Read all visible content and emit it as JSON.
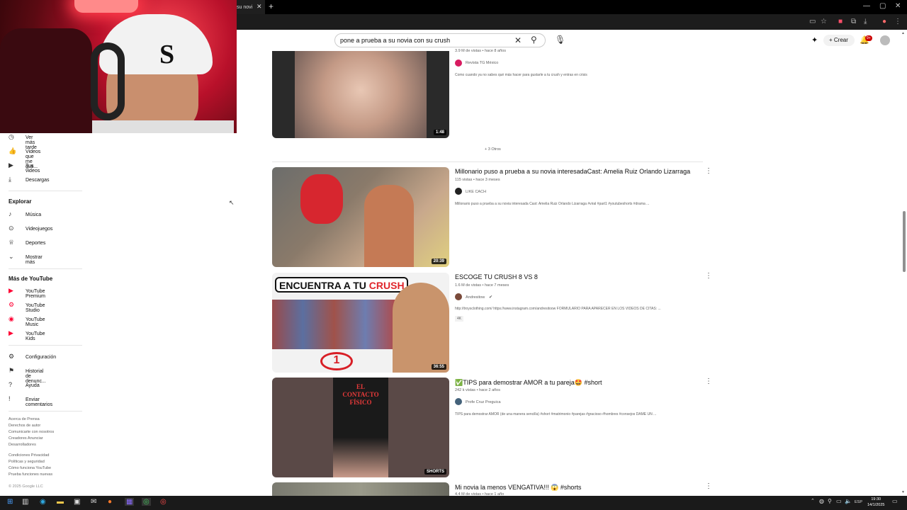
{
  "browser": {
    "tab_title": "su novi",
    "tab_close": "✕",
    "new_tab": "+",
    "window_controls": [
      "—",
      "▢",
      "✕"
    ]
  },
  "header": {
    "search_value": "pone a prueba a su novia con su crush",
    "create_label": "Crear",
    "notif_badge": "9+"
  },
  "sidebar": {
    "top_items": [
      {
        "label": "Ver más tarde",
        "icon": "clock-icon"
      },
      {
        "label": "Videos que me gus...",
        "icon": "thumbs-up-icon"
      },
      {
        "label": "Tus videos",
        "icon": "play-square-icon"
      },
      {
        "label": "Descargas",
        "icon": "download-icon"
      }
    ],
    "explore_title": "Explorar",
    "explore_items": [
      {
        "label": "Música",
        "icon": "music-icon"
      },
      {
        "label": "Videojuegos",
        "icon": "gamepad-icon"
      },
      {
        "label": "Deportes",
        "icon": "trophy-icon"
      },
      {
        "label": "Mostrar más",
        "icon": "chevron-down-icon"
      }
    ],
    "more_title": "Más de YouTube",
    "more_items": [
      {
        "label": "YouTube Premium",
        "icon": "youtube-premium-icon"
      },
      {
        "label": "YouTube Studio",
        "icon": "youtube-studio-icon"
      },
      {
        "label": "YouTube Music",
        "icon": "youtube-music-icon"
      },
      {
        "label": "YouTube Kids",
        "icon": "youtube-kids-icon"
      }
    ],
    "settings_items": [
      {
        "label": "Configuración",
        "icon": "gear-icon"
      },
      {
        "label": "Historial de denunc...",
        "icon": "flag-icon"
      },
      {
        "label": "Ayuda",
        "icon": "help-icon"
      },
      {
        "label": "Enviar comentarios",
        "icon": "feedback-icon"
      }
    ],
    "footer_lines": [
      "Acerca de  Prensa",
      "Derechos de autor",
      "Comunicarte con nosotros",
      "Creadores  Anunciar",
      "Desarrolladores",
      "",
      "Condiciones  Privacidad",
      "Políticas y seguridad",
      "Cómo funciona YouTube",
      "Prueba funciones nuevas"
    ],
    "copyright": "© 2025 Google LLC"
  },
  "results": {
    "more_link": "+ 3 Otros",
    "videos": [
      {
        "meta": "3.9 M de vistas • hace 8 años",
        "channel": "Revista TG México",
        "desc": "Como cuando ya no sabes qué más hacer para gustarle a tu crush y entras en crisis",
        "duration": "1:48"
      },
      {
        "title": "Millonario puso a prueba a su novia interesadaCast: Amelia Ruiz Orlando Lizarraga",
        "meta": "115 vistas • hace 3 meses",
        "channel": "LIKE CACH",
        "desc": "Millonario puso a prueba a su novia interesada Cast: Amelia Ruiz Orlando Lizarraga #viral #part1 #youtubeshorts #drama ...",
        "duration": "20:39"
      },
      {
        "title": "ESCOGE TU CRUSH 8 VS 8",
        "meta": "1.6 M de vistas • hace 7 meses",
        "channel": "Andresitow",
        "desc": "http://troysclothing.com/ https://www.instagram.com/andresitoow FORMULARIO PARA APARECER EN LOS VIDEOS DE CITAS: ...",
        "badge": "4K",
        "thumb_text_1": "ENCUENTRA A TU ",
        "thumb_text_2": "CRUSH",
        "duration": "36:55"
      },
      {
        "title": "✅TIPS para demostrar AMOR a tu pareja🤩 #short",
        "meta": "242 k vistas • hace 2 años",
        "channel": "Profe Cruz Preguica",
        "desc": "TIPS para demostrar AMOR (de una manera sencilla) #short #matrimonio #parejas #gracioso #hombres #consejos DAME UN ...",
        "thumb_text": "EL CONTACTO FÍSICO",
        "duration": "SHORTS"
      },
      {
        "title": "Mi novia la menos VENGATIVA!!! 😱 #shorts",
        "meta": "4.4 M de vistas • hace 1 año"
      }
    ]
  },
  "taskbar": {
    "time": "19:30",
    "date": "14/1/2025",
    "lang": "ESP"
  },
  "colors": {
    "accent": "#ff0033",
    "text_secondary": "#606060"
  }
}
